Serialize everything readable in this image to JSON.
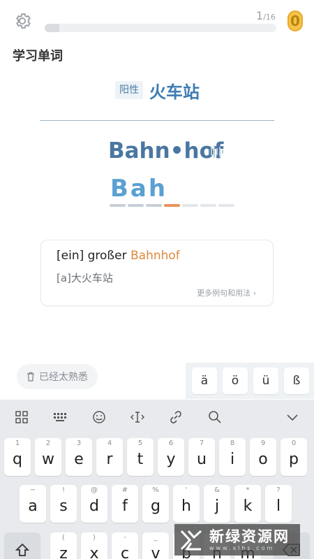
{
  "header": {
    "progress_current": "1",
    "progress_total": "/16",
    "progress_fraction": 0.0625,
    "coin_count": "0"
  },
  "section_title": "学习单词",
  "card": {
    "gender_tag": "阳性",
    "meaning": "火车站",
    "word": "Bahn•hof",
    "typed": "Bah",
    "slots": [
      "filled",
      "filled",
      "filled",
      "active",
      "empty",
      "empty",
      "empty"
    ]
  },
  "example": {
    "prefix": "[ein] großer ",
    "highlight": "Bahnhof",
    "translation": "[a]大火车站",
    "more_label": "更多例句和用法 ›"
  },
  "familiar_button": "已经太熟悉",
  "special_chars": [
    "ä",
    "ö",
    "ü",
    "ß"
  ],
  "keyboard": {
    "row1": [
      {
        "hint": "1",
        "key": "q"
      },
      {
        "hint": "2",
        "key": "w"
      },
      {
        "hint": "3",
        "key": "e"
      },
      {
        "hint": "4",
        "key": "r"
      },
      {
        "hint": "5",
        "key": "t"
      },
      {
        "hint": "6",
        "key": "y"
      },
      {
        "hint": "7",
        "key": "u"
      },
      {
        "hint": "8",
        "key": "i"
      },
      {
        "hint": "9",
        "key": "o"
      },
      {
        "hint": "0",
        "key": "p"
      }
    ],
    "row2": [
      {
        "hint": "~",
        "key": "a"
      },
      {
        "hint": "!",
        "key": "s"
      },
      {
        "hint": "@",
        "key": "d"
      },
      {
        "hint": "#",
        "key": "f"
      },
      {
        "hint": "%",
        "key": "g"
      },
      {
        "hint": "'",
        "key": "h"
      },
      {
        "hint": "&",
        "key": "j"
      },
      {
        "hint": "*",
        "key": "k"
      },
      {
        "hint": "?",
        "key": "l"
      }
    ],
    "row3": [
      {
        "hint": "(",
        "key": "z"
      },
      {
        "hint": ")",
        "key": "x"
      },
      {
        "hint": "-",
        "key": "c"
      },
      {
        "hint": "_",
        "key": "v"
      },
      {
        "hint": ":",
        "key": "b"
      },
      {
        "hint": ";",
        "key": "n"
      },
      {
        "hint": "/",
        "key": "m"
      }
    ]
  },
  "watermark": {
    "main": "新绿资源网",
    "sub": "www.xlhs.com"
  }
}
